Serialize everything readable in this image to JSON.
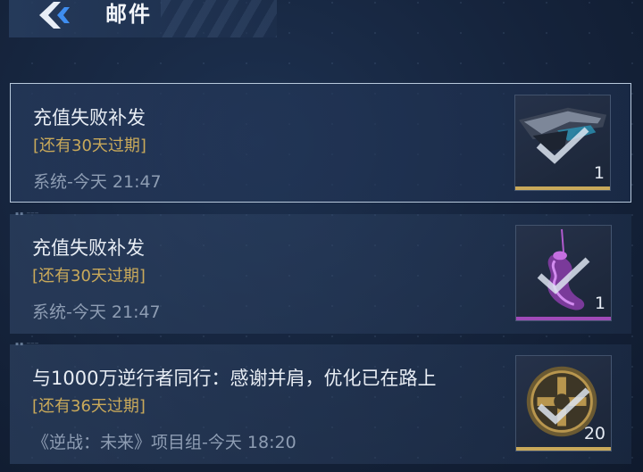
{
  "header": {
    "title": "邮件",
    "back_icon": "back-arrow-icon"
  },
  "mails": [
    {
      "subject": "充值失败补发",
      "expire": "[还有30天过期]",
      "meta": "系统-今天 21:47",
      "selected": true,
      "attachment": {
        "icon": "weapon-rifle-icon",
        "count": "1",
        "claimed": true,
        "rarity_color": "#c9a95a"
      }
    },
    {
      "subject": "充值失败补发",
      "expire": "[还有30天过期]",
      "meta": "系统-今天 21:47",
      "selected": false,
      "attachment": {
        "icon": "purple-charm-icon",
        "count": "1",
        "claimed": true,
        "rarity_color": "#a04ab8"
      }
    },
    {
      "subject": "与1000万逆行者同行：感谢并肩，优化已在路上",
      "expire": "[还有36天过期]",
      "meta": "《逆战：未来》项目组-今天 18:20",
      "selected": false,
      "attachment": {
        "icon": "gold-coin-icon",
        "count": "20",
        "claimed": true,
        "rarity_color": "#c9a95a"
      }
    }
  ]
}
